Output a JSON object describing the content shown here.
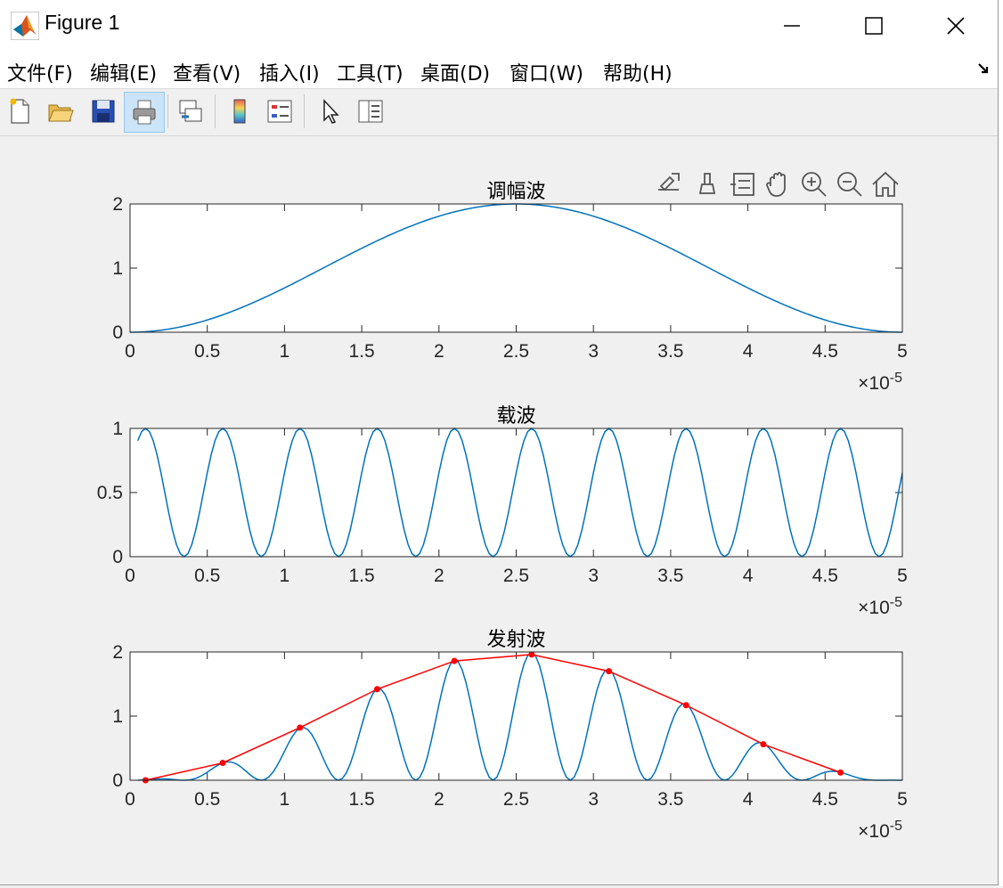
{
  "window": {
    "title": "Figure 1",
    "controls": {
      "minimize": "—",
      "maximize": "☐",
      "close": "✕"
    }
  },
  "menu": {
    "items": [
      {
        "label": "文件(F)",
        "key": "file"
      },
      {
        "label": "编辑(E)",
        "key": "edit"
      },
      {
        "label": "查看(V)",
        "key": "view"
      },
      {
        "label": "插入(I)",
        "key": "insert"
      },
      {
        "label": "工具(T)",
        "key": "tools"
      },
      {
        "label": "桌面(D)",
        "key": "desktop"
      },
      {
        "label": "窗口(W)",
        "key": "window"
      },
      {
        "label": "帮助(H)",
        "key": "help"
      }
    ]
  },
  "toolbar": {
    "icons": [
      "new-figure-icon",
      "open-file-icon",
      "save-icon",
      "print-icon",
      "link-plot-icon",
      "colorbar-icon",
      "legend-icon",
      "select-pointer-icon",
      "property-inspector-icon"
    ],
    "pressed": "print-icon"
  },
  "axes_toolbar": {
    "icons": [
      "export-icon",
      "brush-icon",
      "data-tips-icon",
      "pan-icon",
      "zoom-in-icon",
      "zoom-out-icon",
      "home-icon"
    ]
  },
  "colors": {
    "series": "#0072bd",
    "envelope": "#ff0000",
    "axes_bg": "#ffffff",
    "figure_bg": "#f0f0f0"
  },
  "chart_data": [
    {
      "type": "line",
      "title": "调幅波",
      "x_range": [
        0,
        5e-05
      ],
      "xlim": [
        0,
        5
      ],
      "ylim": [
        0,
        2
      ],
      "xticks": [
        "0",
        "0.5",
        "1",
        "1.5",
        "2",
        "2.5",
        "3",
        "3.5",
        "4",
        "4.5",
        "5"
      ],
      "yticks": [
        "0",
        "1",
        "2"
      ],
      "x_exponent_base": "×10",
      "x_exponent": "-5",
      "series": [
        {
          "function": "1 - cos(2*pi*x/5e-5)",
          "x_range": [
            0,
            5e-05
          ]
        }
      ]
    },
    {
      "type": "line",
      "title": "载波",
      "x_range": [
        0,
        5e-05
      ],
      "xlim": [
        0,
        5
      ],
      "ylim": [
        0,
        1
      ],
      "xticks": [
        "0",
        "0.5",
        "1",
        "1.5",
        "2",
        "2.5",
        "3",
        "3.5",
        "4",
        "4.5",
        "5"
      ],
      "yticks": [
        "0",
        "0.5",
        "1"
      ],
      "x_exponent_base": "×10",
      "x_exponent": "-5",
      "series": [
        {
          "function": "cos^2(2*pi*1e5*(x - 1e-6))",
          "x_range": [
            5e-07,
            5e-05
          ],
          "sample_step": 2.5e-07
        }
      ]
    },
    {
      "type": "line",
      "title": "发射波",
      "x_range": [
        0,
        5e-05
      ],
      "xlim": [
        0,
        5
      ],
      "ylim": [
        0,
        2
      ],
      "xticks": [
        "0",
        "0.5",
        "1",
        "1.5",
        "2",
        "2.5",
        "3",
        "3.5",
        "4",
        "4.5",
        "5"
      ],
      "yticks": [
        "0",
        "1",
        "2"
      ],
      "x_exponent_base": "×10",
      "x_exponent": "-5",
      "series": [
        {
          "function": "(1 - cos(2*pi*x/5e-5)) * cos^2(2*pi*1e5*(x - 1e-6))",
          "x_range": [
            5e-07,
            5e-05
          ],
          "sample_step": 2.5e-07
        },
        {
          "style": "envelope",
          "x": [
            1e-06,
            6e-06,
            1.1e-05,
            1.6e-05,
            2.1e-05,
            2.6e-05,
            3.1e-05,
            3.6e-05,
            4.1e-05,
            4.6e-05
          ],
          "y": [
            0.0,
            0.27,
            0.82,
            1.42,
            1.86,
            1.96,
            1.7,
            1.17,
            0.56,
            0.12
          ]
        }
      ]
    }
  ]
}
